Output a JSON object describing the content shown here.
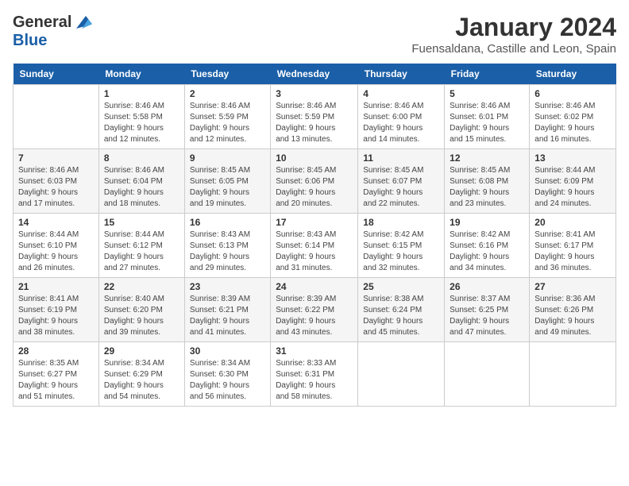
{
  "header": {
    "logo_general": "General",
    "logo_blue": "Blue",
    "month_title": "January 2024",
    "location": "Fuensaldana, Castille and Leon, Spain"
  },
  "days_of_week": [
    "Sunday",
    "Monday",
    "Tuesday",
    "Wednesday",
    "Thursday",
    "Friday",
    "Saturday"
  ],
  "weeks": [
    [
      {
        "day": "",
        "info": ""
      },
      {
        "day": "1",
        "info": "Sunrise: 8:46 AM\nSunset: 5:58 PM\nDaylight: 9 hours\nand 12 minutes."
      },
      {
        "day": "2",
        "info": "Sunrise: 8:46 AM\nSunset: 5:59 PM\nDaylight: 9 hours\nand 12 minutes."
      },
      {
        "day": "3",
        "info": "Sunrise: 8:46 AM\nSunset: 5:59 PM\nDaylight: 9 hours\nand 13 minutes."
      },
      {
        "day": "4",
        "info": "Sunrise: 8:46 AM\nSunset: 6:00 PM\nDaylight: 9 hours\nand 14 minutes."
      },
      {
        "day": "5",
        "info": "Sunrise: 8:46 AM\nSunset: 6:01 PM\nDaylight: 9 hours\nand 15 minutes."
      },
      {
        "day": "6",
        "info": "Sunrise: 8:46 AM\nSunset: 6:02 PM\nDaylight: 9 hours\nand 16 minutes."
      }
    ],
    [
      {
        "day": "7",
        "info": "Sunrise: 8:46 AM\nSunset: 6:03 PM\nDaylight: 9 hours\nand 17 minutes."
      },
      {
        "day": "8",
        "info": "Sunrise: 8:46 AM\nSunset: 6:04 PM\nDaylight: 9 hours\nand 18 minutes."
      },
      {
        "day": "9",
        "info": "Sunrise: 8:45 AM\nSunset: 6:05 PM\nDaylight: 9 hours\nand 19 minutes."
      },
      {
        "day": "10",
        "info": "Sunrise: 8:45 AM\nSunset: 6:06 PM\nDaylight: 9 hours\nand 20 minutes."
      },
      {
        "day": "11",
        "info": "Sunrise: 8:45 AM\nSunset: 6:07 PM\nDaylight: 9 hours\nand 22 minutes."
      },
      {
        "day": "12",
        "info": "Sunrise: 8:45 AM\nSunset: 6:08 PM\nDaylight: 9 hours\nand 23 minutes."
      },
      {
        "day": "13",
        "info": "Sunrise: 8:44 AM\nSunset: 6:09 PM\nDaylight: 9 hours\nand 24 minutes."
      }
    ],
    [
      {
        "day": "14",
        "info": "Sunrise: 8:44 AM\nSunset: 6:10 PM\nDaylight: 9 hours\nand 26 minutes."
      },
      {
        "day": "15",
        "info": "Sunrise: 8:44 AM\nSunset: 6:12 PM\nDaylight: 9 hours\nand 27 minutes."
      },
      {
        "day": "16",
        "info": "Sunrise: 8:43 AM\nSunset: 6:13 PM\nDaylight: 9 hours\nand 29 minutes."
      },
      {
        "day": "17",
        "info": "Sunrise: 8:43 AM\nSunset: 6:14 PM\nDaylight: 9 hours\nand 31 minutes."
      },
      {
        "day": "18",
        "info": "Sunrise: 8:42 AM\nSunset: 6:15 PM\nDaylight: 9 hours\nand 32 minutes."
      },
      {
        "day": "19",
        "info": "Sunrise: 8:42 AM\nSunset: 6:16 PM\nDaylight: 9 hours\nand 34 minutes."
      },
      {
        "day": "20",
        "info": "Sunrise: 8:41 AM\nSunset: 6:17 PM\nDaylight: 9 hours\nand 36 minutes."
      }
    ],
    [
      {
        "day": "21",
        "info": "Sunrise: 8:41 AM\nSunset: 6:19 PM\nDaylight: 9 hours\nand 38 minutes."
      },
      {
        "day": "22",
        "info": "Sunrise: 8:40 AM\nSunset: 6:20 PM\nDaylight: 9 hours\nand 39 minutes."
      },
      {
        "day": "23",
        "info": "Sunrise: 8:39 AM\nSunset: 6:21 PM\nDaylight: 9 hours\nand 41 minutes."
      },
      {
        "day": "24",
        "info": "Sunrise: 8:39 AM\nSunset: 6:22 PM\nDaylight: 9 hours\nand 43 minutes."
      },
      {
        "day": "25",
        "info": "Sunrise: 8:38 AM\nSunset: 6:24 PM\nDaylight: 9 hours\nand 45 minutes."
      },
      {
        "day": "26",
        "info": "Sunrise: 8:37 AM\nSunset: 6:25 PM\nDaylight: 9 hours\nand 47 minutes."
      },
      {
        "day": "27",
        "info": "Sunrise: 8:36 AM\nSunset: 6:26 PM\nDaylight: 9 hours\nand 49 minutes."
      }
    ],
    [
      {
        "day": "28",
        "info": "Sunrise: 8:35 AM\nSunset: 6:27 PM\nDaylight: 9 hours\nand 51 minutes."
      },
      {
        "day": "29",
        "info": "Sunrise: 8:34 AM\nSunset: 6:29 PM\nDaylight: 9 hours\nand 54 minutes."
      },
      {
        "day": "30",
        "info": "Sunrise: 8:34 AM\nSunset: 6:30 PM\nDaylight: 9 hours\nand 56 minutes."
      },
      {
        "day": "31",
        "info": "Sunrise: 8:33 AM\nSunset: 6:31 PM\nDaylight: 9 hours\nand 58 minutes."
      },
      {
        "day": "",
        "info": ""
      },
      {
        "day": "",
        "info": ""
      },
      {
        "day": "",
        "info": ""
      }
    ]
  ]
}
